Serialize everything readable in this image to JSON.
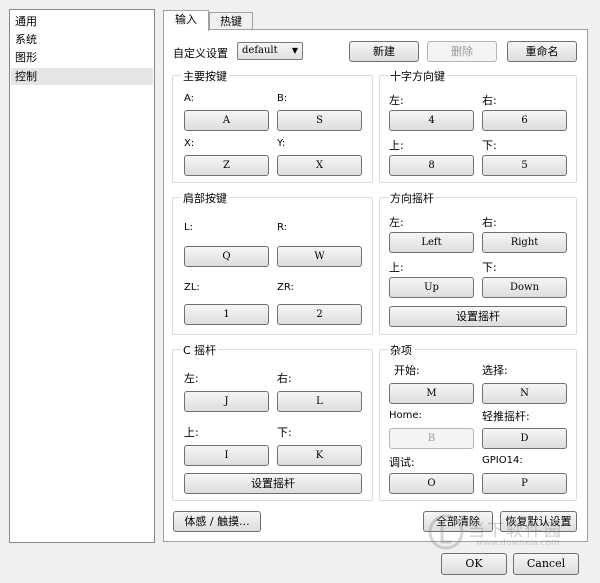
{
  "sidebar": {
    "items": [
      "通用",
      "系统",
      "图形",
      "控制"
    ],
    "selected": 3
  },
  "tabs": [
    "输入",
    "热键"
  ],
  "profile": {
    "label": "自定义设置",
    "value": "default",
    "new": "新建",
    "delete": "删除",
    "rename": "重命名"
  },
  "groups": {
    "main_buttons": {
      "title": "主要按键",
      "a": "A:",
      "b": "B:",
      "x": "X:",
      "y": "Y:",
      "a_val": "A",
      "b_val": "S",
      "x_val": "Z",
      "y_val": "X"
    },
    "dpad": {
      "title": "十字方向键",
      "left": "左:",
      "right": "右:",
      "up": "上:",
      "down": "下:",
      "left_val": "4",
      "right_val": "6",
      "up_val": "8",
      "down_val": "5"
    },
    "shoulder": {
      "title": "肩部按键",
      "l": "L:",
      "r": "R:",
      "zl": "ZL:",
      "zr": "ZR:",
      "l_val": "Q",
      "r_val": "W",
      "zl_val": "1",
      "zr_val": "2"
    },
    "circle_pad": {
      "title": "方向摇杆",
      "left": "左:",
      "right": "右:",
      "up": "上:",
      "down": "下:",
      "left_val": "Left",
      "right_val": "Right",
      "up_val": "Up",
      "down_val": "Down",
      "setup": "设置摇杆"
    },
    "c_stick": {
      "title": "C 摇杆",
      "left": "左:",
      "right": "右:",
      "up": "上:",
      "down": "下:",
      "left_val": "J",
      "right_val": "L",
      "up_val": "I",
      "down_val": "K",
      "setup": "设置摇杆"
    },
    "misc": {
      "title": "杂项",
      "start": "开始:",
      "select": "选择:",
      "home": "Home:",
      "light_stick": "轻推摇杆:",
      "debug": "调试:",
      "gpio": "GPIO14:",
      "start_val": "M",
      "select_val": "N",
      "home_val": "B",
      "light_val": "D",
      "debug_val": "O",
      "gpio_val": "P"
    }
  },
  "bottom": {
    "motion": "体感 / 触摸...",
    "clear_all": "全部清除",
    "restore": "恢复默认设置"
  },
  "footer": {
    "ok": "OK",
    "cancel": "Cancel"
  },
  "watermark": {
    "text": "当下软件园",
    "url": "www.downxia.com"
  }
}
